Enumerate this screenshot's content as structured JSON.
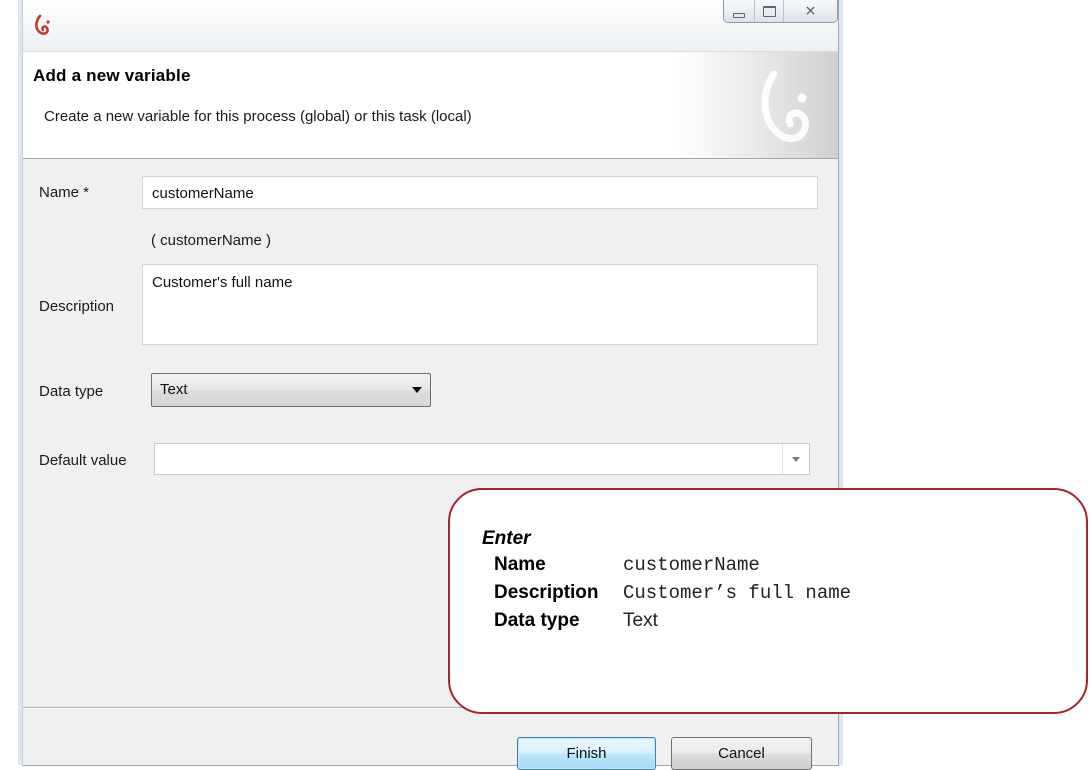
{
  "window": {
    "controls": {
      "minimize": "minimize",
      "maximize": "maximize",
      "close": "close"
    },
    "close_glyph": "⨯"
  },
  "header": {
    "title": "Add a new variable",
    "subtitle": "Create a new variable for this process (global) or this task (local)"
  },
  "form": {
    "name_label": "Name *",
    "name_value": "customerName",
    "name_preview": "(  customerName  )",
    "description_label": "Description",
    "description_value": "Customer's full name",
    "datatype_label": "Data type",
    "datatype_value": "Text",
    "default_label": "Default value",
    "default_value": ""
  },
  "buttons": {
    "finish": "Finish",
    "cancel": "Cancel"
  },
  "callout": {
    "title": "Enter",
    "rows": [
      {
        "key": "Name",
        "value": "customerName"
      },
      {
        "key": "Description",
        "value": "Customer’s full name"
      },
      {
        "key": "Data type",
        "value": "Text"
      }
    ]
  },
  "colors": {
    "accent_red": "#a3242a",
    "brand_red": "#c23a2e",
    "finish_border": "#3c7fb1"
  },
  "icons": {
    "app": "bonita-logo-icon",
    "watermark": "bonita-watermark-icon",
    "dropdown": "chevron-down-icon"
  }
}
